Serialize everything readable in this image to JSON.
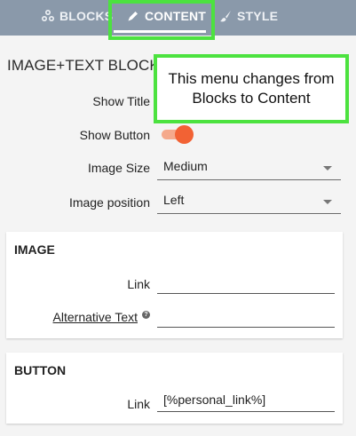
{
  "tabs": {
    "blocks": "BLOCKS",
    "content": "CONTENT",
    "style": "STYLE"
  },
  "panel": {
    "title": "IMAGE+TEXT BLOCK"
  },
  "callout": {
    "text": "This menu changes from Blocks to Content"
  },
  "settings": {
    "show_title_label": "Show Title",
    "show_button_label": "Show Button",
    "show_button_on": true,
    "image_size_label": "Image Size",
    "image_size_value": "Medium",
    "image_position_label": "Image position",
    "image_position_value": "Left"
  },
  "image_card": {
    "title": "IMAGE",
    "link_label": "Link",
    "link_value": "",
    "alt_label": "Alternative Text",
    "alt_value": ""
  },
  "button_card": {
    "title": "BUTTON",
    "link_label": "Link",
    "link_value": "[%personal_link%]"
  },
  "colors": {
    "tabbar": "#8a99aa",
    "highlight": "#4ce23f",
    "toggle_on": "#f26234"
  }
}
